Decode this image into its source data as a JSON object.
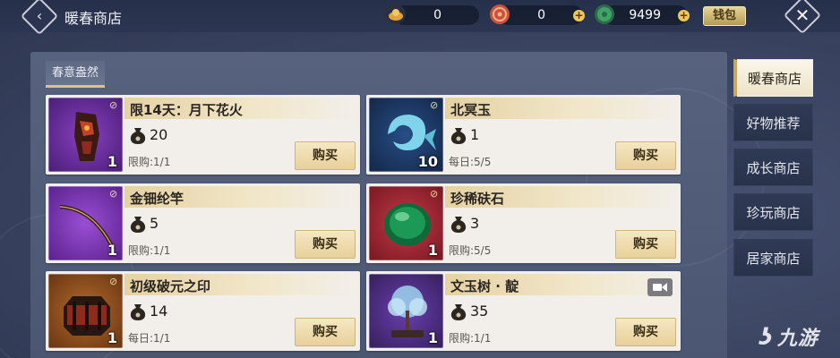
{
  "header": {
    "title": "暖春商店",
    "currencies": [
      {
        "icon": "gold-ingot-icon",
        "value": "0",
        "color": "#e3a23a"
      },
      {
        "icon": "red-coin-icon",
        "value": "0",
        "color": "#c9533a"
      },
      {
        "icon": "jade-coin-icon",
        "value": "9499",
        "color": "#3fa36a"
      }
    ],
    "wallet_label": "钱包"
  },
  "subtab": {
    "label": "春意盎然"
  },
  "items": [
    {
      "name": "限14天：月下花火",
      "price": "20",
      "limit": "限购:1/1",
      "quantity": "1",
      "buy": "购买",
      "thumb_color": "#5a2c8c",
      "icon": "firework-outfit-icon"
    },
    {
      "name": "北冥玉",
      "price": "1",
      "limit": "每日:5/5",
      "quantity": "10",
      "buy": "购买",
      "thumb_color": "#1b3a6b",
      "icon": "fish-jade-icon"
    },
    {
      "name": "金钿纶竿",
      "price": "5",
      "limit": "限购:1/1",
      "quantity": "1",
      "buy": "购买",
      "thumb_color": "#6d2fa6",
      "icon": "fishing-rod-icon"
    },
    {
      "name": "珍稀砆石",
      "price": "3",
      "limit": "限购:5/5",
      "quantity": "1",
      "buy": "购买",
      "thumb_color": "#9a2130",
      "icon": "green-stone-icon"
    },
    {
      "name": "初级破元之印",
      "price": "14",
      "limit": "每日:1/1",
      "quantity": "1",
      "buy": "购买",
      "thumb_color": "#8a4b1c",
      "icon": "seal-box-icon"
    },
    {
      "name": "文玉树 · 靛",
      "price": "35",
      "limit": "限购:1/1",
      "quantity": "1",
      "buy": "购买",
      "thumb_color": "#4a2d7e",
      "icon": "jade-tree-icon"
    }
  ],
  "nav": [
    {
      "label": "暖春商店",
      "active": true
    },
    {
      "label": "好物推荐",
      "active": false
    },
    {
      "label": "成长商店",
      "active": false
    },
    {
      "label": "珍玩商店",
      "active": false
    },
    {
      "label": "居家商店",
      "active": false
    }
  ],
  "watermark": {
    "text": "九游"
  }
}
